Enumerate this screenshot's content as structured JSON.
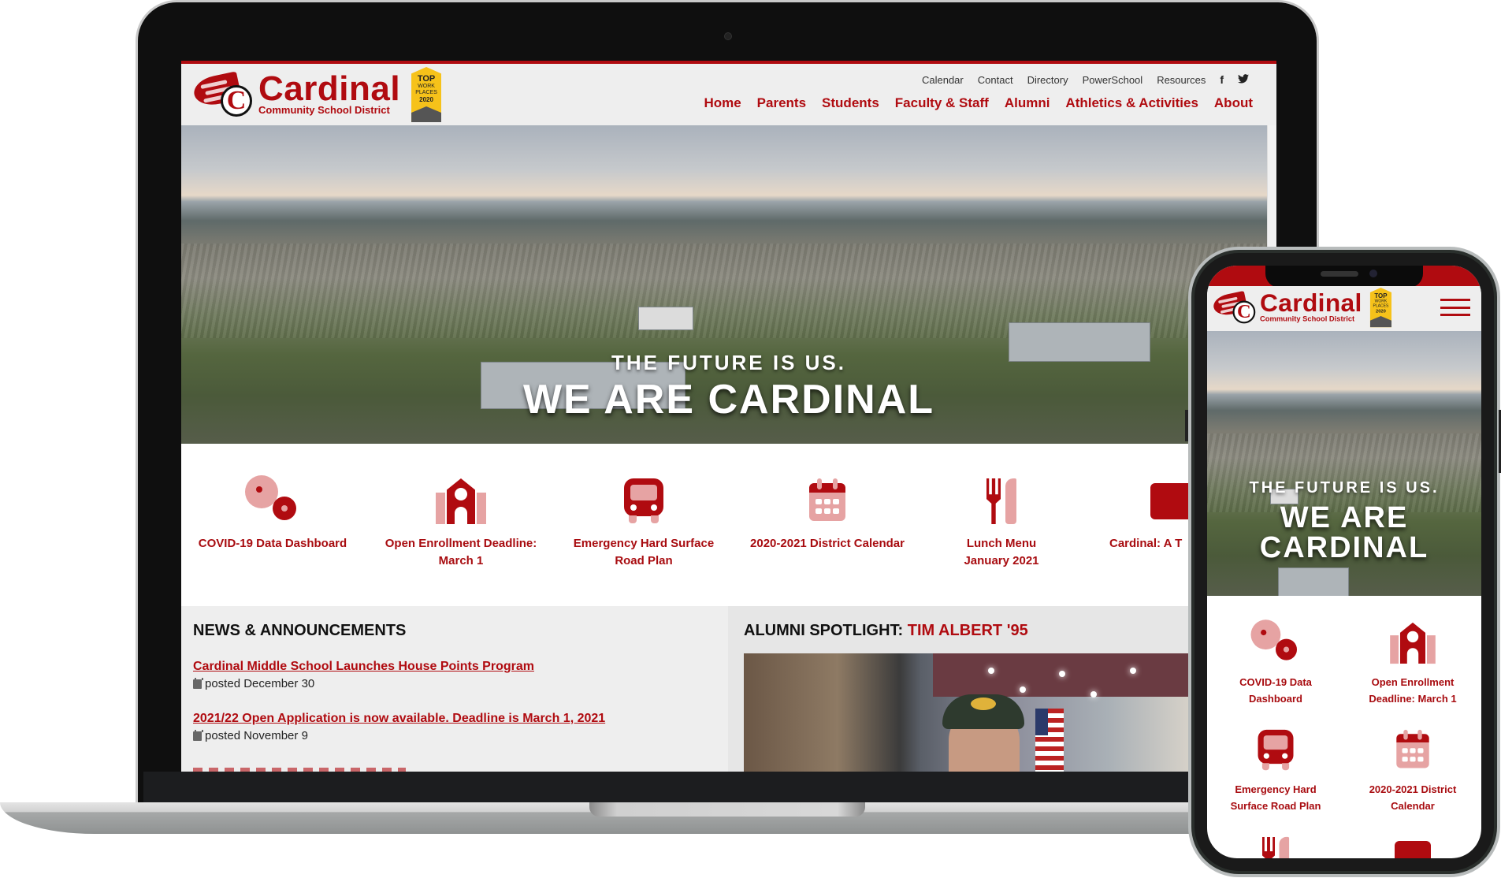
{
  "site": {
    "logo_title": "Cardinal",
    "logo_subtitle": "Community School District",
    "badge": {
      "line1": "TOP",
      "line2": "WORK",
      "line3": "PLACES",
      "year": "2020"
    },
    "brand_color": "#b00b10",
    "accent_light": "#e6a3a3"
  },
  "utility_nav": [
    {
      "label": "Calendar"
    },
    {
      "label": "Contact"
    },
    {
      "label": "Directory"
    },
    {
      "label": "PowerSchool"
    },
    {
      "label": "Resources"
    }
  ],
  "social": {
    "facebook": "f",
    "twitter": "🐦"
  },
  "main_nav": [
    {
      "label": "Home"
    },
    {
      "label": "Parents"
    },
    {
      "label": "Students"
    },
    {
      "label": "Faculty & Staff"
    },
    {
      "label": "Alumni"
    },
    {
      "label": "Athletics & Activities"
    },
    {
      "label": "About"
    }
  ],
  "hero": {
    "subtitle": "THE FUTURE IS US.",
    "title": "WE ARE CARDINAL",
    "title_line1": "WE ARE",
    "title_line2": "CARDINAL"
  },
  "quick_links": [
    {
      "icon": "virus-icon",
      "label": "COVID-19 Data Dashboard",
      "label_line1": "COVID-19 Data",
      "label_line2": "Dashboard"
    },
    {
      "icon": "school-icon",
      "label_line1": "Open Enrollment Deadline:",
      "label_line2": "March 1",
      "mobile_line1": "Open Enrollment",
      "mobile_line2": "Deadline: March 1"
    },
    {
      "icon": "bus-icon",
      "label_line1": "Emergency Hard Surface",
      "label_line2": "Road Plan",
      "mobile_line1": "Emergency Hard",
      "mobile_line2": "Surface Road Plan"
    },
    {
      "icon": "calendar-icon",
      "label": "2020-2021 District Calendar",
      "mobile_line1": "2020-2021 District",
      "mobile_line2": "Calendar"
    },
    {
      "icon": "utensils-icon",
      "label_line1": "Lunch Menu",
      "label_line2": "January 2021"
    },
    {
      "icon": "video-icon",
      "label": "Cardinal: A T"
    }
  ],
  "news": {
    "heading": "NEWS & ANNOUNCEMENTS",
    "items": [
      {
        "title": "Cardinal Middle School Launches House Points Program",
        "posted": "posted December 30"
      },
      {
        "title": "2021/22 Open Application is now available. Deadline is March 1, 2021",
        "posted": "posted November 9"
      }
    ]
  },
  "alumni": {
    "heading": "ALUMNI SPOTLIGHT:",
    "name": "TIM ALBERT '95"
  }
}
